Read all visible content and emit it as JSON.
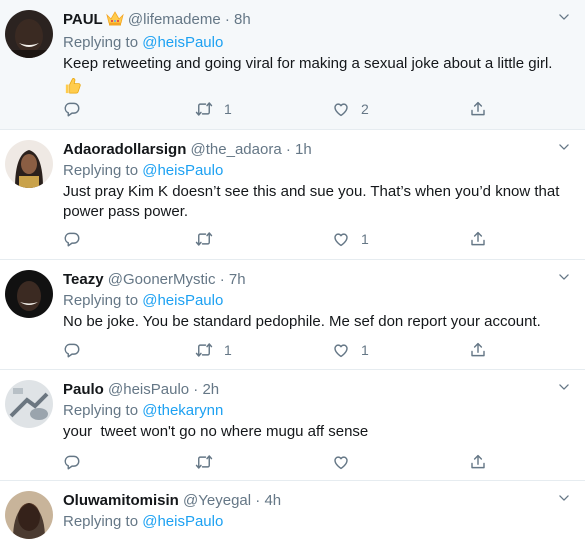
{
  "tweets": [
    {
      "name": "PAUL",
      "handle": "@lifemademe",
      "dot": "·",
      "time": "8h",
      "reply_prefix": "Replying to",
      "reply_to": "@heisPaulo",
      "text": "Keep retweeting and going viral for making a sexual joke about a little girl.",
      "retweets": "1",
      "likes": "2"
    },
    {
      "name": "Adaoradollarsign",
      "handle": "@the_adaora",
      "dot": "·",
      "time": "1h",
      "reply_prefix": "Replying to",
      "reply_to": "@heisPaulo",
      "text": "Just pray Kim K doesn’t see this and sue you. That’s when you’d know that power pass power.",
      "retweets": "",
      "likes": "1"
    },
    {
      "name": "Teazy",
      "handle": "@GoonerMystic",
      "dot": "·",
      "time": "7h",
      "reply_prefix": "Replying to",
      "reply_to": "@heisPaulo",
      "text": "No be joke. You be standard pedophile. Me sef don report your account.",
      "retweets": "1",
      "likes": "1"
    },
    {
      "name": "Paulo",
      "handle": "@heisPaulo",
      "dot": "·",
      "time": "2h",
      "reply_prefix": "Replying to",
      "reply_to": "@thekarynn",
      "text": "your  tweet won't go no where mugu aff sense",
      "retweets": "",
      "likes": ""
    },
    {
      "name": "Oluwamitomisin",
      "handle": "@Yeyegal",
      "dot": "·",
      "time": "4h",
      "reply_prefix": "Replying to",
      "reply_to": "@heisPaulo"
    }
  ],
  "colors": {
    "link": "#1da1f2",
    "muted": "#657786",
    "text": "#14171a",
    "highlight_bg": "#f5f8fa",
    "divider": "#e6ecf0"
  },
  "icons": [
    "crown-emoji",
    "thumbs-up-emoji",
    "reply-icon",
    "retweet-icon",
    "like-icon",
    "share-icon",
    "chevron-down-icon"
  ]
}
